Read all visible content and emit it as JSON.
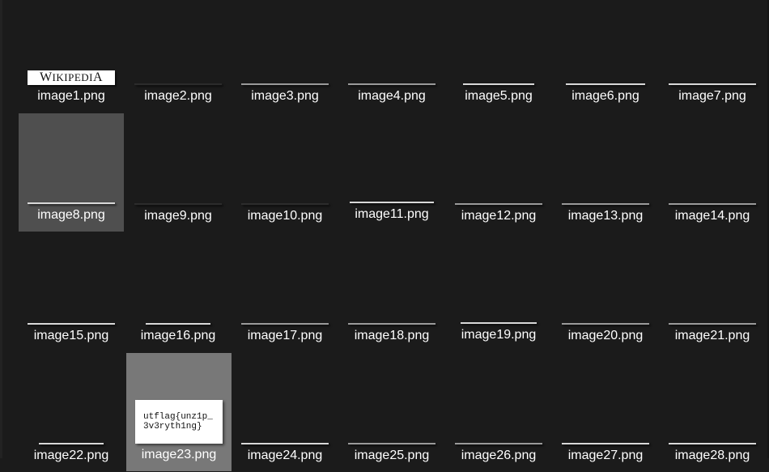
{
  "files": [
    {
      "name": "image1.png"
    },
    {
      "name": "image2.png"
    },
    {
      "name": "image3.png"
    },
    {
      "name": "image4.png"
    },
    {
      "name": "image5.png"
    },
    {
      "name": "image6.png"
    },
    {
      "name": "image7.png"
    },
    {
      "name": "image8.png"
    },
    {
      "name": "image9.png"
    },
    {
      "name": "image10.png"
    },
    {
      "name": "image11.png"
    },
    {
      "name": "image12.png"
    },
    {
      "name": "image13.png"
    },
    {
      "name": "image14.png"
    },
    {
      "name": "image15.png"
    },
    {
      "name": "image16.png"
    },
    {
      "name": "image17.png"
    },
    {
      "name": "image18.png"
    },
    {
      "name": "image19.png"
    },
    {
      "name": "image20.png"
    },
    {
      "name": "image21.png"
    },
    {
      "name": "image22.png"
    },
    {
      "name": "image23.png"
    },
    {
      "name": "image24.png"
    },
    {
      "name": "image25.png"
    },
    {
      "name": "image26.png"
    },
    {
      "name": "image27.png"
    },
    {
      "name": "image28.png"
    }
  ],
  "thumbs": {
    "logo_text_big1": "W",
    "logo_text_small1": "IKIPEDI",
    "logo_text_big2": "A",
    "flag_line1": "utflag{unz1p_",
    "flag_line2": "3v3ryth1ng}"
  },
  "colors": {
    "background": "#1b1b1b",
    "selected_tile": "#4f4f4f",
    "selected_tile_alt": "#787878",
    "label_text": "#ffffff"
  }
}
